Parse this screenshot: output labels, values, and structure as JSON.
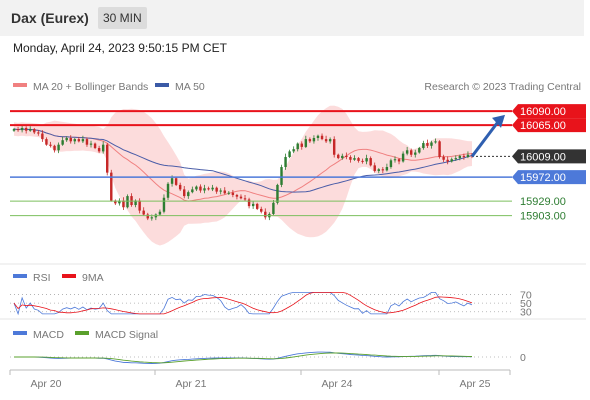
{
  "header": {
    "title": "Dax (Eurex)",
    "interval": "30 MIN",
    "datetime": "Monday, April 24, 2023 9:50:15 PM CET"
  },
  "legend": {
    "bb": "MA 20 + Bollinger Bands",
    "ma50": "MA 50",
    "credit": "Research © 2023 Trading Central"
  },
  "rsi_legend": {
    "rsi": "RSI",
    "ma": "9MA"
  },
  "macd_legend": {
    "macd": "MACD",
    "signal": "MACD Signal"
  },
  "colors": {
    "resistance": "#e8131b",
    "support": "#4d79d9",
    "target": "#7cbf5e",
    "up": "#2e7d32",
    "down": "#c62828",
    "band": "#fbd0d0",
    "ma20": "#f08080",
    "ma50": "#4a5da8"
  },
  "chart_data": [
    {
      "type": "candlestick",
      "title": "Dax (Eurex)",
      "ylim": [
        15820,
        16110
      ],
      "x_ticks": [
        "Apr 20",
        "Apr 21",
        "Apr 24",
        "Apr 25"
      ],
      "levels": [
        {
          "value": 16090.0,
          "label": "16090.00",
          "kind": "resistance"
        },
        {
          "value": 16065.0,
          "label": "16065.00",
          "kind": "resistance"
        },
        {
          "value": 16009.0,
          "label": "16009.00",
          "kind": "last"
        },
        {
          "value": 15972.0,
          "label": "15972.00",
          "kind": "support"
        },
        {
          "value": 15929.0,
          "label": "15929.00",
          "kind": "target"
        },
        {
          "value": 15903.0,
          "label": "15903.00",
          "kind": "target"
        }
      ],
      "close": [
        16058,
        16056,
        16060,
        16055,
        16058,
        16052,
        16050,
        16040,
        16030,
        16028,
        16020,
        16030,
        16038,
        16042,
        16036,
        16040,
        16036,
        16040,
        16030,
        16032,
        16024,
        16018,
        16030,
        15980,
        15930,
        15925,
        15930,
        15918,
        15938,
        15922,
        15930,
        15912,
        15905,
        15898,
        15900,
        15905,
        15910,
        15935,
        15960,
        15970,
        15958,
        15950,
        15938,
        15945,
        15950,
        15955,
        15948,
        15952,
        15950,
        15953,
        15946,
        15948,
        15943,
        15944,
        15940,
        15937,
        15934,
        15932,
        15920,
        15924,
        15915,
        15910,
        15900,
        15906,
        15926,
        15958,
        15990,
        16008,
        16018,
        16022,
        16032,
        16026,
        16040,
        16036,
        16042,
        16046,
        16040,
        16036,
        16040,
        16012,
        16006,
        16010,
        16008,
        16003,
        16006,
        16001,
        16000,
        16006,
        15993,
        15983,
        15986,
        15984,
        15990,
        16002,
        16004,
        16000,
        16014,
        16020,
        16012,
        16016,
        16024,
        16033,
        16028,
        16034,
        16036,
        16008,
        16003,
        16000,
        16004,
        16006,
        16010,
        16008,
        16012,
        16009
      ]
    },
    {
      "type": "line",
      "title": "RSI",
      "levels": [
        70,
        50,
        30
      ],
      "series": [
        {
          "name": "RSI"
        },
        {
          "name": "9MA"
        }
      ]
    },
    {
      "type": "line",
      "title": "MACD",
      "levels": [
        0
      ],
      "series": [
        {
          "name": "MACD"
        },
        {
          "name": "MACD Signal"
        }
      ]
    }
  ]
}
